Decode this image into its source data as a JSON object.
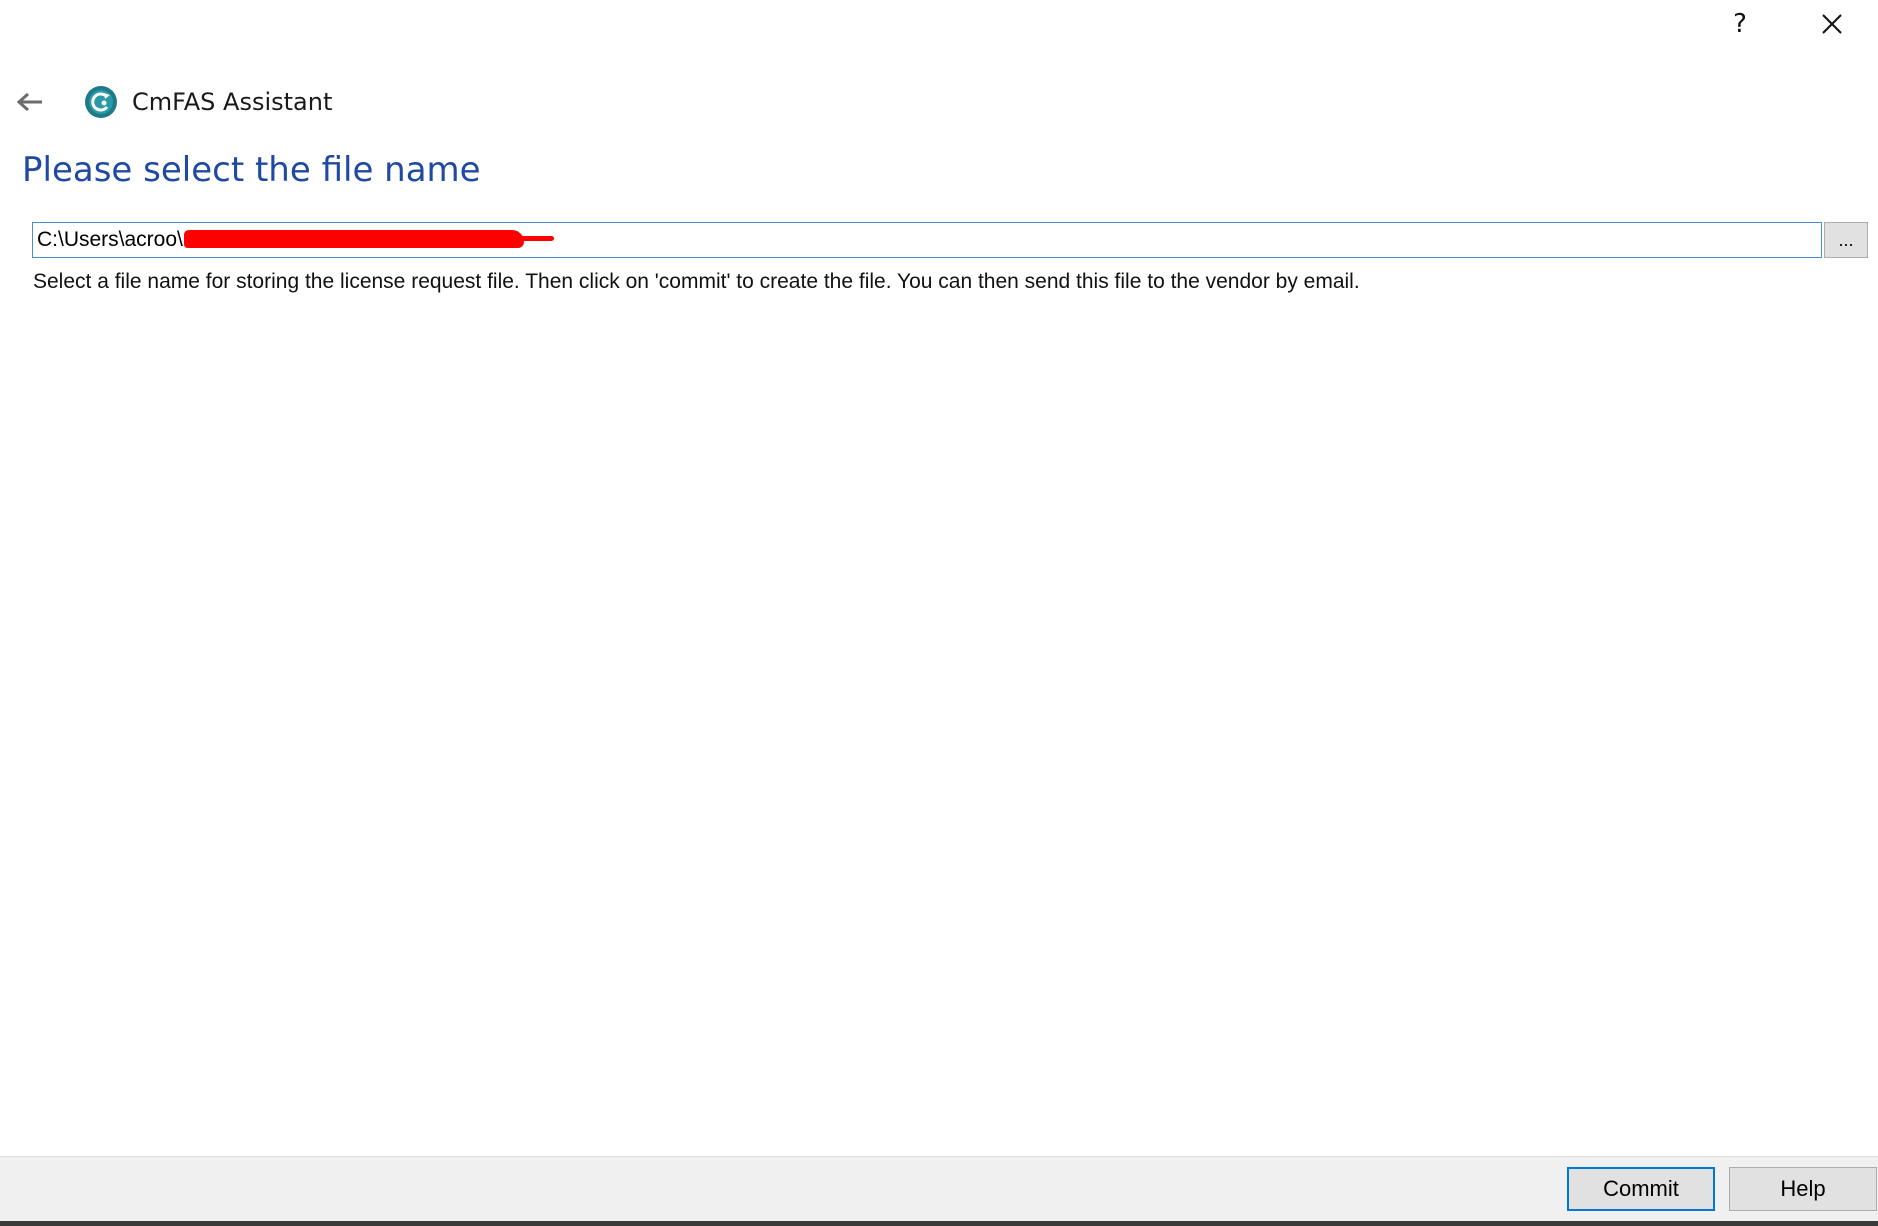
{
  "window": {
    "help_glyph": "?",
    "close_glyph": "✕"
  },
  "nav": {
    "app_title": "CmFAS Assistant"
  },
  "main": {
    "heading": "Please select the file name",
    "path_value": "C:\\Users\\acroo\\",
    "browse_label": "...",
    "description": "Select a file name for storing the license request file. Then click on 'commit' to create the file. You can then send this file to the vendor by email."
  },
  "footer": {
    "commit_label": "Commit",
    "help_label": "Help"
  },
  "colors": {
    "heading": "#1f49a3",
    "logo": "#1e7a86",
    "input_border": "#4a8fd6",
    "primary_button_border": "#0078d7",
    "redaction": "#ff0000"
  },
  "icons": {
    "back": "back-arrow-icon",
    "logo": "cmfas-logo-icon",
    "help": "question-mark-icon",
    "close": "close-icon"
  }
}
